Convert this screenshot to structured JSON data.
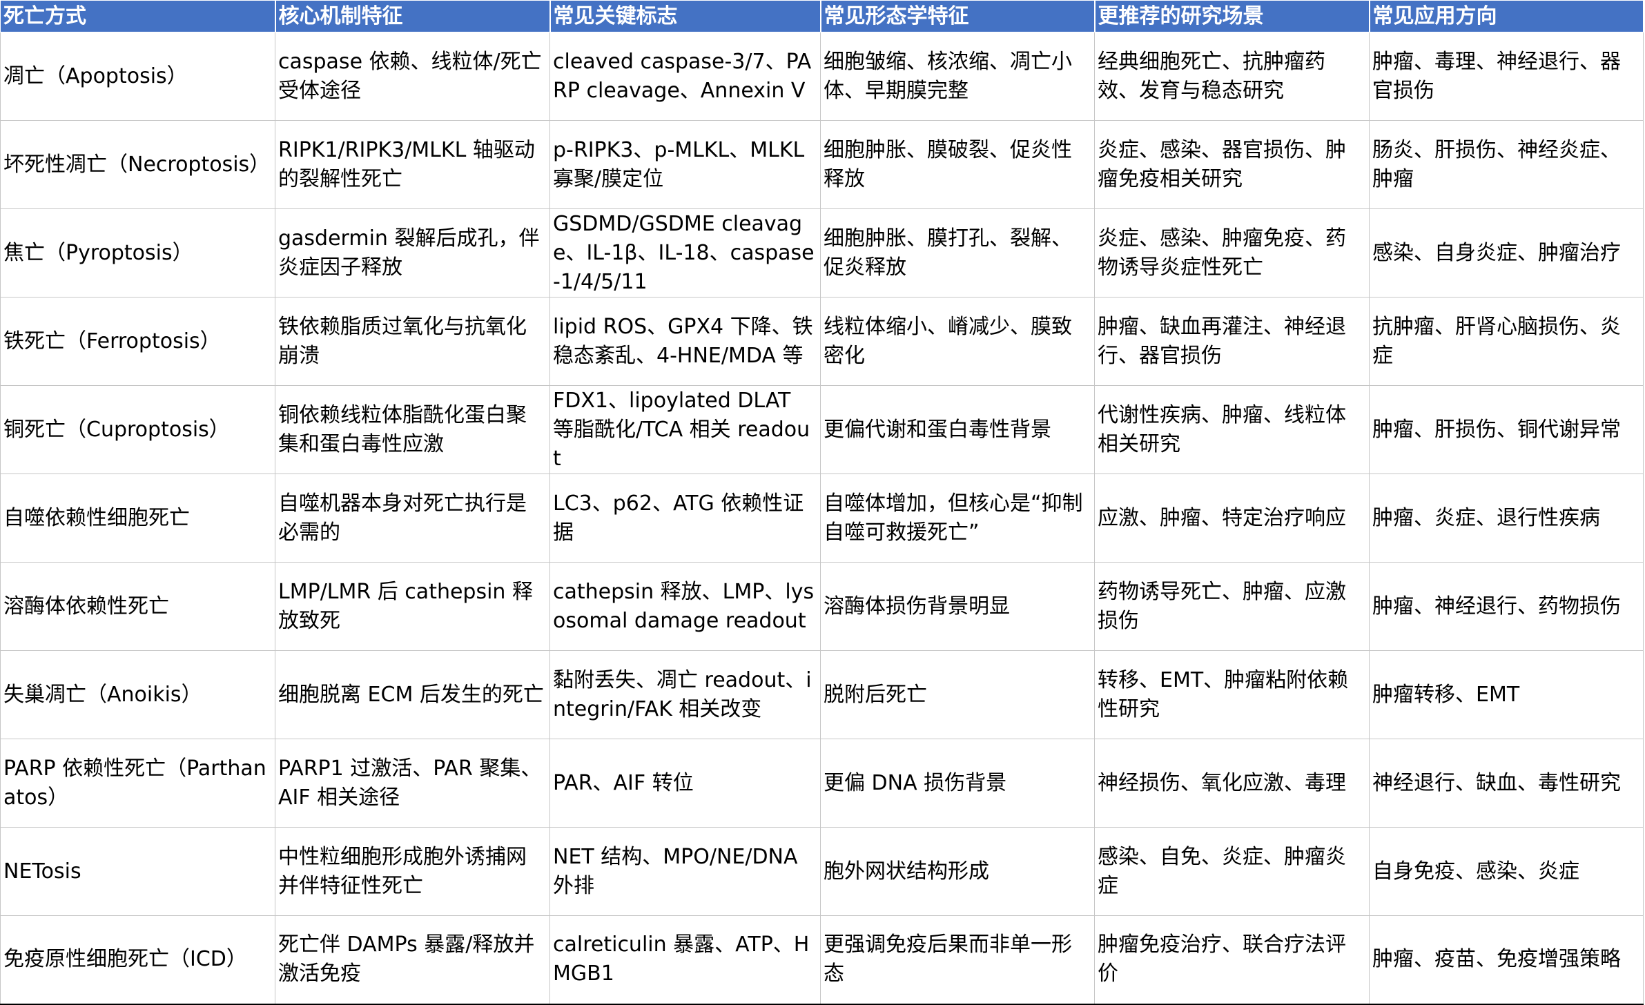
{
  "header": [
    "死亡方式",
    "核心机制特征",
    "常见关键标志",
    "常见形态学特征",
    "更推荐的研究场景",
    "常见应用方向"
  ],
  "rows": [
    [
      "凋亡（Apoptosis）",
      "caspase 依赖、线粒体/死亡受体途径",
      "cleaved caspase-3/7、PARP cleavage、Annexin V",
      "细胞皱缩、核浓缩、凋亡小体、早期膜完整",
      "经典细胞死亡、抗肿瘤药效、发育与稳态研究",
      "肿瘤、毒理、神经退行、器官损伤"
    ],
    [
      "坏死性凋亡（Necroptosis）",
      "RIPK1/RIPK3/MLKL 轴驱动的裂解性死亡",
      "p-RIPK3、p-MLKL、MLKL 寡聚/膜定位",
      "细胞肿胀、膜破裂、促炎性释放",
      "炎症、感染、器官损伤、肿瘤免疫相关研究",
      "肠炎、肝损伤、神经炎症、肿瘤"
    ],
    [
      "焦亡（Pyroptosis）",
      "gasdermin 裂解后成孔，伴炎症因子释放",
      "GSDMD/GSDME cleavage、IL-1β、IL-18、caspase-1/4/5/11",
      "细胞肿胀、膜打孔、裂解、促炎释放",
      "炎症、感染、肿瘤免疫、药物诱导炎症性死亡",
      "感染、自身炎症、肿瘤治疗"
    ],
    [
      "铁死亡（Ferroptosis）",
      "铁依赖脂质过氧化与抗氧化崩溃",
      "lipid ROS、GPX4 下降、铁稳态紊乱、4-HNE/MDA 等",
      "线粒体缩小、嵴减少、膜致密化",
      "肿瘤、缺血再灌注、神经退行、器官损伤",
      "抗肿瘤、肝肾心脑损伤、炎症"
    ],
    [
      "铜死亡（Cuproptosis）",
      "铜依赖线粒体脂酰化蛋白聚集和蛋白毒性应激",
      "FDX1、lipoylated DLAT 等脂酰化/TCA 相关 readout",
      "更偏代谢和蛋白毒性背景",
      "代谢性疾病、肿瘤、线粒体相关研究",
      "肿瘤、肝损伤、铜代谢异常"
    ],
    [
      "自噬依赖性细胞死亡",
      "自噬机器本身对死亡执行是必需的",
      "LC3、p62、ATG 依赖性证据",
      "自噬体增加，但核心是“抑制自噬可救援死亡”",
      "应激、肿瘤、特定治疗响应",
      "肿瘤、炎症、退行性疾病"
    ],
    [
      "溶酶体依赖性死亡",
      "LMP/LMR 后 cathepsin 释放致死",
      "cathepsin 释放、LMP、lysosomal damage readout",
      "溶酶体损伤背景明显",
      "药物诱导死亡、肿瘤、应激损伤",
      "肿瘤、神经退行、药物损伤"
    ],
    [
      "失巢凋亡（Anoikis）",
      "细胞脱离 ECM 后发生的死亡",
      "黏附丢失、凋亡 readout、integrin/FAK 相关改变",
      "脱附后死亡",
      "转移、EMT、肿瘤粘附依赖性研究",
      "肿瘤转移、EMT"
    ],
    [
      "PARP 依赖性死亡（Parthanatos）",
      "PARP1 过激活、PAR 聚集、AIF 相关途径",
      "PAR、AIF 转位",
      "更偏 DNA 损伤背景",
      "神经损伤、氧化应激、毒理",
      "神经退行、缺血、毒性研究"
    ],
    [
      "NETosis",
      "中性粒细胞形成胞外诱捕网并伴特征性死亡",
      "NET 结构、MPO/NE/DNA 外排",
      "胞外网状结构形成",
      "感染、自免、炎症、肿瘤炎症",
      "自身免疫、感染、炎症"
    ],
    [
      "免疫原性细胞死亡（ICD）",
      "死亡伴 DAMPs 暴露/释放并激活免疫",
      "calreticulin 暴露、ATP、HMGB1",
      "更强调免疫后果而非单一形态",
      "肿瘤免疫治疗、联合疗法评价",
      "肿瘤、疫苗、免疫增强策略"
    ]
  ]
}
